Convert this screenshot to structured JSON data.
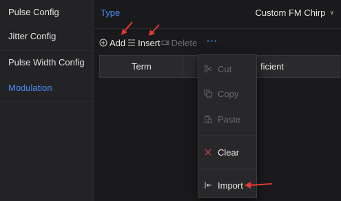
{
  "sidebar": {
    "items": [
      {
        "label": "Pulse Config",
        "active": false
      },
      {
        "label": "Jitter Config",
        "active": false
      },
      {
        "label": "Pulse Width Config",
        "active": false
      },
      {
        "label": "Modulation",
        "active": true
      }
    ]
  },
  "main": {
    "type_label": "Type",
    "type_value": "Custom FM Chirp",
    "toolbar": {
      "add": "Add",
      "insert": "Insert",
      "delete": "Delete",
      "more": "···"
    },
    "table": {
      "columns": [
        "Term",
        "ficient"
      ]
    }
  },
  "context_menu": {
    "items": [
      {
        "label": "Cut",
        "enabled": false,
        "icon": "scissors-icon"
      },
      {
        "label": "Copy",
        "enabled": false,
        "icon": "copy-icon"
      },
      {
        "label": "Paste",
        "enabled": false,
        "icon": "paste-icon"
      },
      {
        "label": "Clear",
        "enabled": true,
        "icon": "close-icon"
      },
      {
        "label": "Import",
        "enabled": true,
        "icon": "import-icon"
      }
    ]
  },
  "colors": {
    "accent": "#4a8cf7",
    "annotation": "#e53935",
    "clear_icon": "#e2463c"
  }
}
